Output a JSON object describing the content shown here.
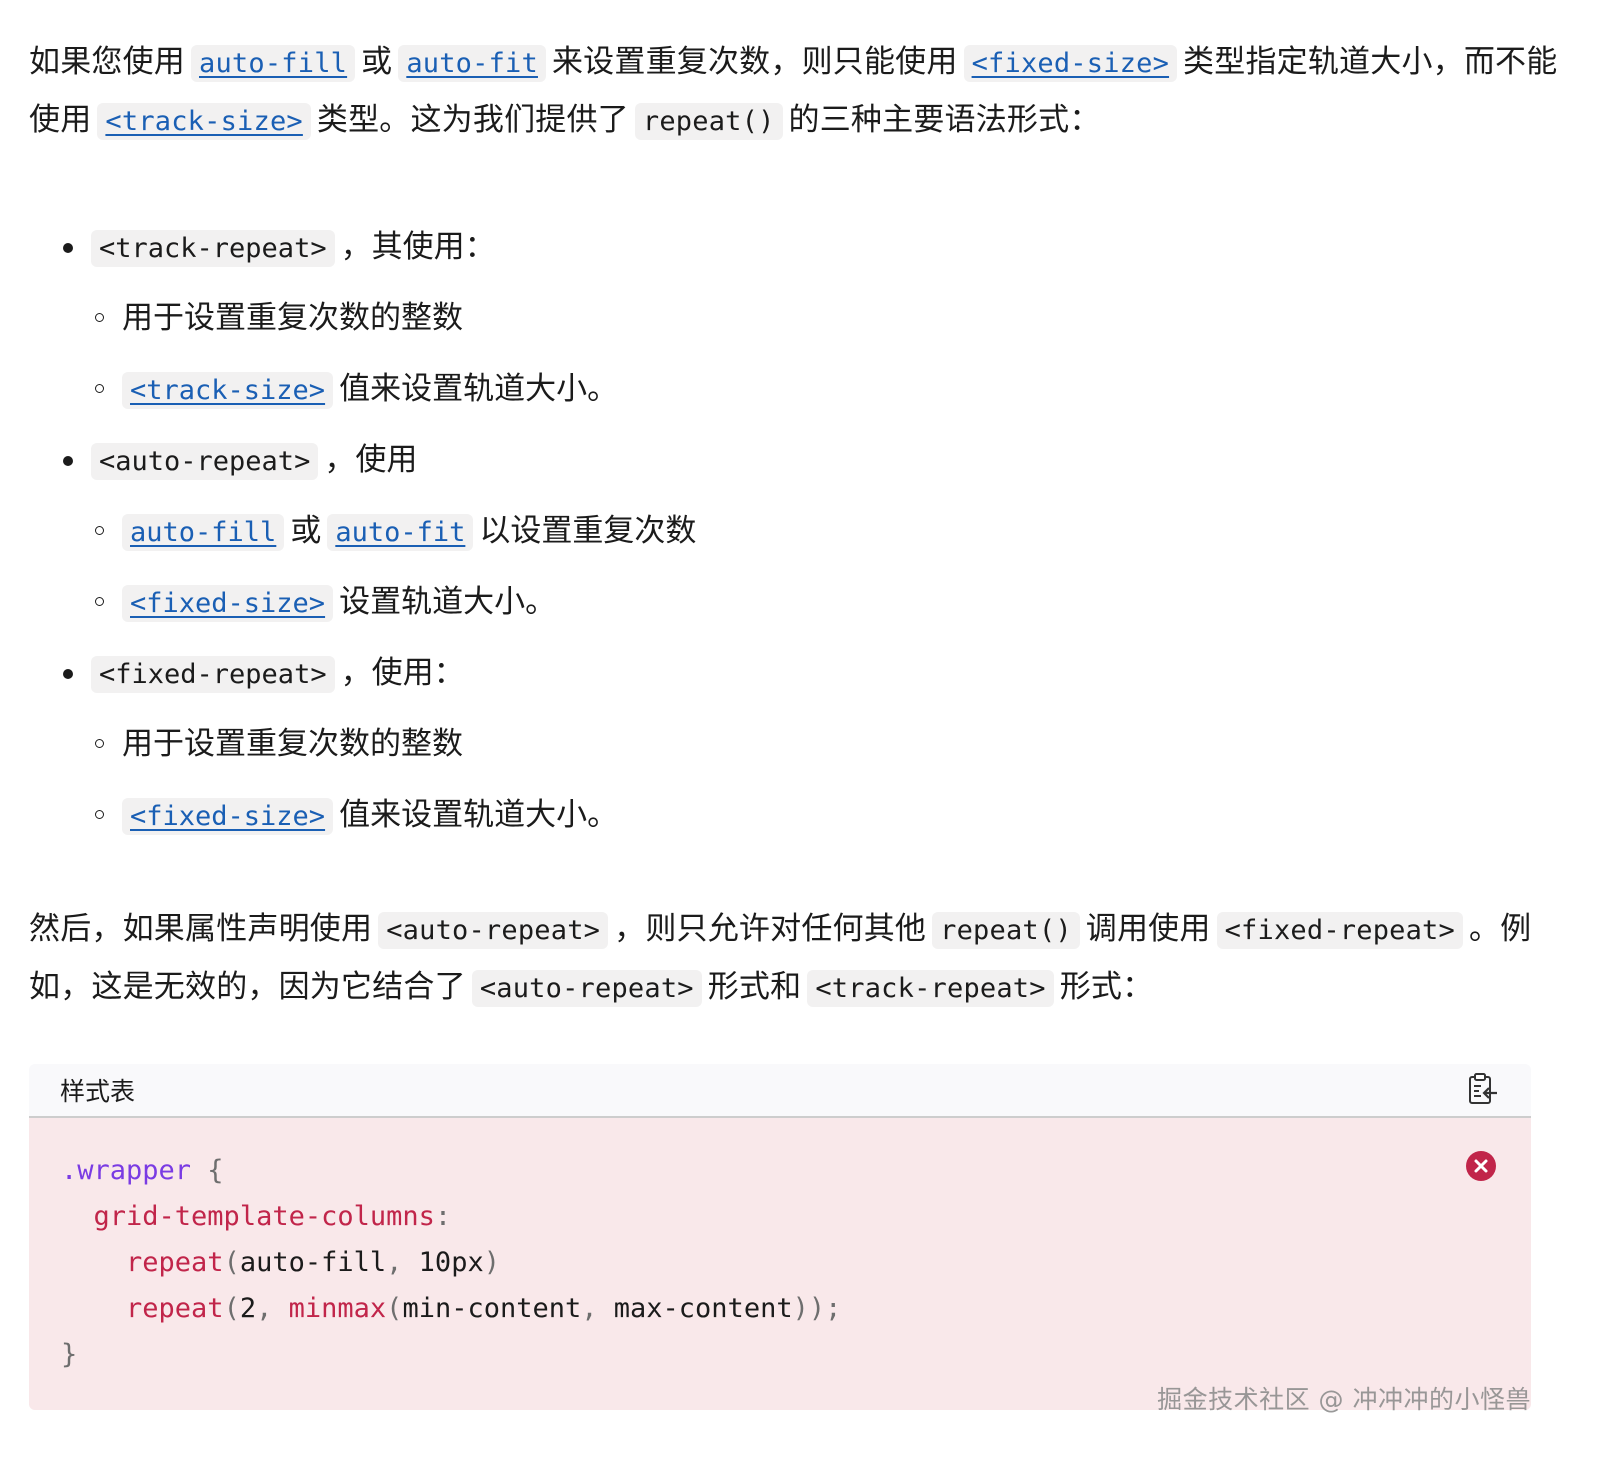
{
  "intro": {
    "t1": "如果您使用",
    "c1": "auto-fill",
    "t2": "或",
    "c2": "auto-fit",
    "t3": "来设置重复次数，则只能使用",
    "c3": "<fixed-size>",
    "t4": "类型指定轨道大小，而不能使用",
    "c4": "<track-size>",
    "t5": "类型。这为我们提供了",
    "c5": "repeat()",
    "t6": "的三种主要语法形式："
  },
  "list": [
    {
      "code": "<track-repeat>",
      "text": "，其使用：",
      "subitems": [
        {
          "text": "用于设置重复次数的整数"
        },
        {
          "link": "<track-size>",
          "text": "值来设置轨道大小。"
        }
      ]
    },
    {
      "code": "<auto-repeat>",
      "text": "，使用",
      "subitems": [
        {
          "link1": "auto-fill",
          "mid": "或",
          "link2": "auto-fit",
          "text": "以设置重复次数"
        },
        {
          "link": "<fixed-size>",
          "text": "设置轨道大小。"
        }
      ]
    },
    {
      "code": "<fixed-repeat>",
      "text": "，使用：",
      "subitems": [
        {
          "text": "用于设置重复次数的整数"
        },
        {
          "link": "<fixed-size>",
          "text": "值来设置轨道大小。"
        }
      ]
    }
  ],
  "para2": {
    "t1": "然后，如果属性声明使用",
    "c1": "<auto-repeat>",
    "t2": "，则只允许对任何其他",
    "c2": "repeat()",
    "t3": "调用使用",
    "c3": "<fixed-repeat>",
    "t4": "。例如，这是无效的，因为它结合了",
    "c4": "<auto-repeat>",
    "t5": "形式和",
    "c5": "<track-repeat>",
    "t6": "形式："
  },
  "codeblock": {
    "language": "样式表",
    "copy_icon": "clipboard-copy-icon",
    "error_icon": "error-x-icon",
    "error_color": "#c1254a",
    "lines": {
      "l1_sel": ".wrapper",
      "l1_brace": " {",
      "l2_prop": "grid-template-columns",
      "l2_colon": ":",
      "l3_fn": "repeat",
      "l3_open": "(",
      "l3_args": "auto-fill",
      "l3_comma": ",",
      "l3_val": " 10px",
      "l3_close": ")",
      "l4_fn": "repeat",
      "l4_open": "(",
      "l4_num": "2",
      "l4_comma1": ",",
      "l4_fn2": " minmax",
      "l4_open2": "(",
      "l4_a": "min-content",
      "l4_comma2": ",",
      "l4_b": " max-content",
      "l4_close": "))",
      "l4_semi": ";",
      "l5_brace": "}"
    }
  },
  "watermark": "掘金技术社区 @ 冲冲冲的小怪兽"
}
